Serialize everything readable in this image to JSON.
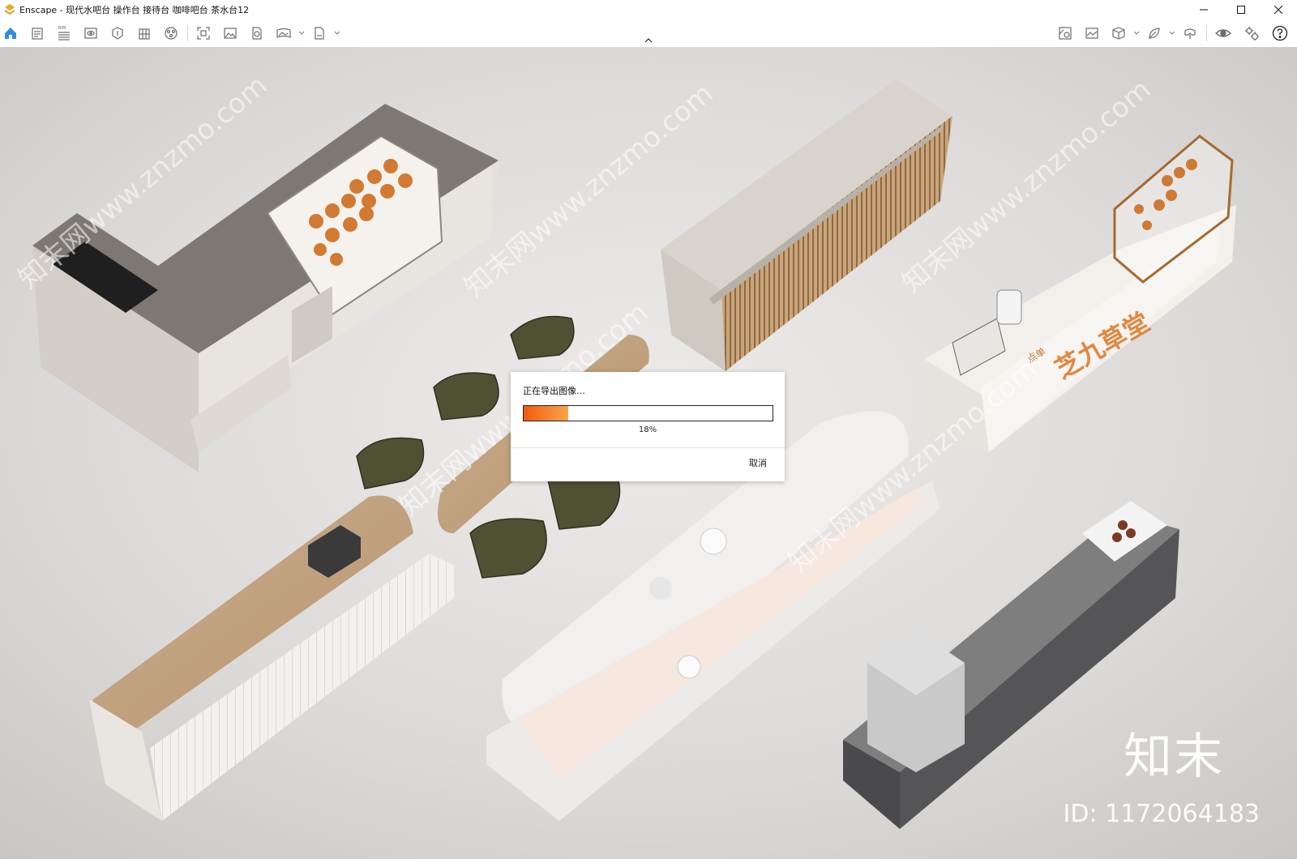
{
  "window": {
    "title": "Enscape - 现代水吧台 操作台 接待台 咖啡吧台 茶水台12",
    "minimize_icon": "minimize-icon",
    "maximize_icon": "maximize-icon",
    "close_icon": "close-icon"
  },
  "toolbar": {
    "collapse_icon": "chevron-up-icon",
    "bim_label": "BIM",
    "left_tools": [
      "home-icon",
      "notes-icon",
      "bim-icon",
      "view-icon",
      "asset-library-icon",
      "building-icon",
      "material-icon",
      "screenshot-icon",
      "image-icon",
      "web-export-icon",
      "panorama-icon",
      "exe-export-icon"
    ],
    "right_tools": [
      "site-context-icon",
      "image-capture-icon",
      "cube-icon",
      "leaf-icon",
      "vr-icon",
      "visibility-icon",
      "settings-icon",
      "help-icon"
    ]
  },
  "viewport": {
    "brand_watermark": "知末",
    "id_watermark": "ID: 1172064183",
    "diagonal_watermark": "知末网www.znzmo.com",
    "signboard_text": "芝九草堂",
    "signboard_small_text": "点单"
  },
  "export_dialog": {
    "title": "正在导出图像…",
    "progress": 0.18,
    "percent_label": "18%",
    "cancel_label": "取消",
    "progress_colors": [
      "#f15a12",
      "#f7a64b"
    ]
  }
}
